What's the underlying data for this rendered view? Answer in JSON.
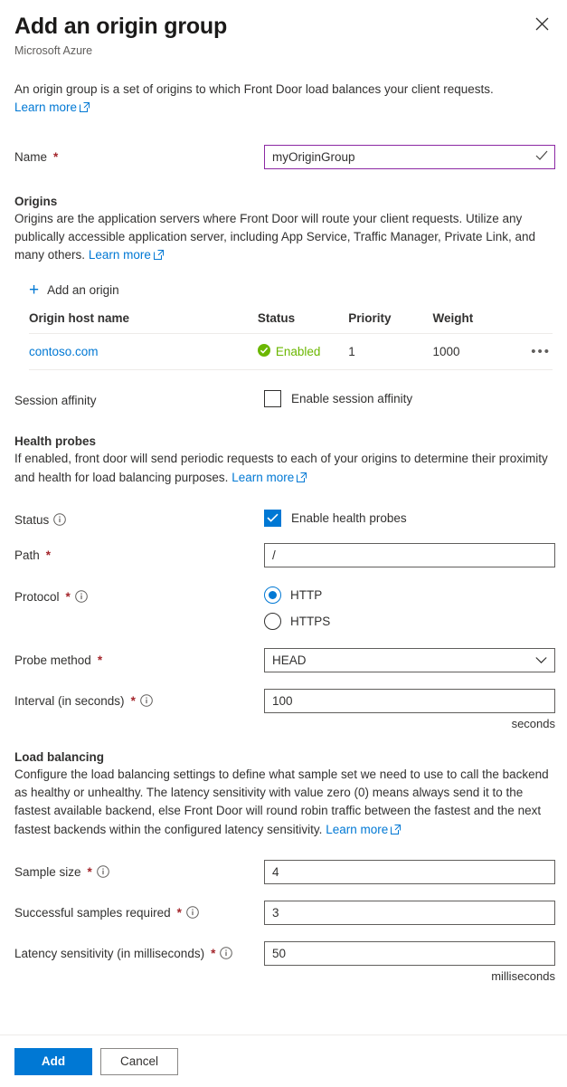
{
  "header": {
    "title": "Add an origin group",
    "subtitle": "Microsoft Azure",
    "close_label": "Close"
  },
  "intro": {
    "text": "An origin group is a set of origins to which Front Door load balances your client requests.",
    "learn_more": "Learn more"
  },
  "name_field": {
    "label": "Name",
    "required": "*",
    "value": "myOriginGroup"
  },
  "origins": {
    "title": "Origins",
    "description": "Origins are the application servers where Front Door will route your client requests. Utilize any publically accessible application server, including App Service, Traffic Manager, Private Link, and many others.",
    "learn_more": "Learn more",
    "add_origin_label": "Add an origin",
    "columns": [
      "Origin host name",
      "Status",
      "Priority",
      "Weight"
    ],
    "rows": [
      {
        "host": "contoso.com",
        "status": "Enabled",
        "priority": "1",
        "weight": "1000",
        "menu": "•••"
      }
    ]
  },
  "session_affinity": {
    "label": "Session affinity",
    "checkbox_label": "Enable session affinity",
    "checked": false
  },
  "health_probes": {
    "title": "Health probes",
    "description": "If enabled, front door will send periodic requests to each of your origins to determine their proximity and health for load balancing purposes.",
    "learn_more": "Learn more",
    "status": {
      "label": "Status",
      "checkbox_label": "Enable health probes",
      "checked": true
    },
    "path": {
      "label": "Path",
      "required": "*",
      "value": "/"
    },
    "protocol": {
      "label": "Protocol",
      "required": "*",
      "options": [
        "HTTP",
        "HTTPS"
      ],
      "selected": "HTTP"
    },
    "probe_method": {
      "label": "Probe method",
      "required": "*",
      "value": "HEAD"
    },
    "interval": {
      "label": "Interval (in seconds)",
      "required": "*",
      "value": "100",
      "unit": "seconds"
    }
  },
  "load_balancing": {
    "title": "Load balancing",
    "description": "Configure the load balancing settings to define what sample set we need to use to call the backend as healthy or unhealthy. The latency sensitivity with value zero (0) means always send it to the fastest available backend, else Front Door will round robin traffic between the fastest and the next fastest backends within the configured latency sensitivity.",
    "learn_more": "Learn more",
    "sample_size": {
      "label": "Sample size",
      "required": "*",
      "value": "4"
    },
    "successful_samples": {
      "label": "Successful samples required",
      "required": "*",
      "value": "3"
    },
    "latency_sensitivity": {
      "label": "Latency sensitivity (in milliseconds)",
      "required": "*",
      "value": "50",
      "unit": "milliseconds"
    }
  },
  "footer": {
    "add_label": "Add",
    "cancel_label": "Cancel"
  },
  "colors": {
    "accent": "#0078d4",
    "status_green": "#6bb700",
    "required_red": "#a4262c",
    "focus_purple": "#8c28a3"
  }
}
